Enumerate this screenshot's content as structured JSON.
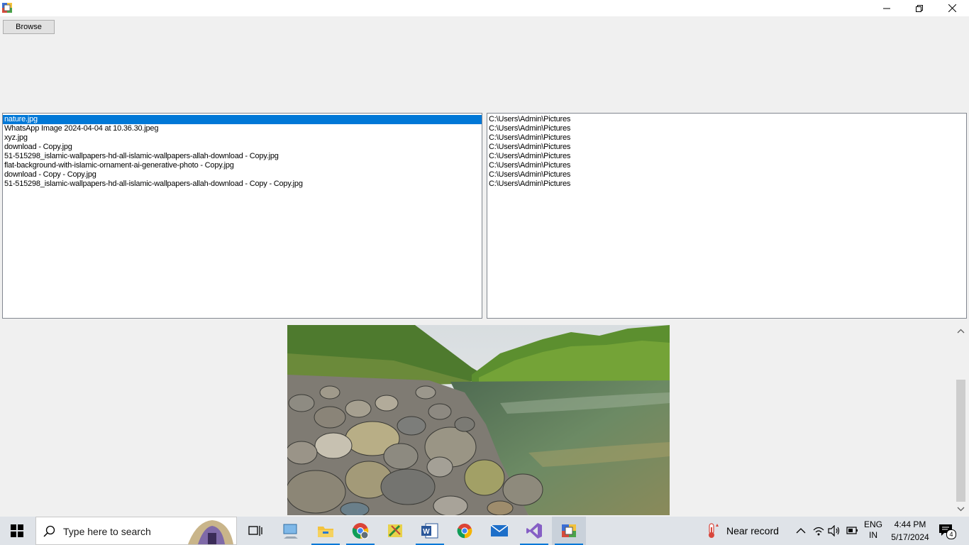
{
  "window": {
    "controls": {
      "minimize_icon": "minimize-icon",
      "restore_icon": "restore-icon",
      "close_icon": "close-icon"
    }
  },
  "toolbar": {
    "browse_label": "Browse"
  },
  "file_list": {
    "selected_index": 0,
    "items": [
      "nature.jpg",
      "WhatsApp Image 2024-04-04 at 10.36.30.jpeg",
      "xyz.jpg",
      "download - Copy.jpg",
      "51-515298_islamic-wallpapers-hd-all-islamic-wallpapers-allah-download - Copy.jpg",
      "flat-background-with-islamic-ornament-ai-generative-photo - Copy.jpg",
      "download - Copy - Copy.jpg",
      "51-515298_islamic-wallpapers-hd-all-islamic-wallpapers-allah-download - Copy - Copy.jpg"
    ]
  },
  "path_list": {
    "items": [
      "C:\\Users\\Admin\\Pictures",
      "C:\\Users\\Admin\\Pictures",
      "C:\\Users\\Admin\\Pictures",
      "C:\\Users\\Admin\\Pictures",
      "C:\\Users\\Admin\\Pictures",
      "C:\\Users\\Admin\\Pictures",
      "C:\\Users\\Admin\\Pictures",
      "C:\\Users\\Admin\\Pictures"
    ]
  },
  "taskbar": {
    "search_placeholder": "Type here to search",
    "weather_text": "Near record",
    "lang_line1": "ENG",
    "lang_line2": "IN",
    "time": "4:44 PM",
    "date": "5/17/2024",
    "notification_count": "4",
    "accent_color": "#0078d7"
  }
}
